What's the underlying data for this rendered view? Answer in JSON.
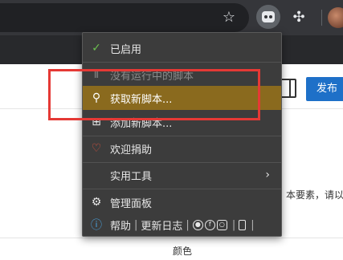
{
  "toolbar": {
    "icons": {
      "star": "star-icon",
      "extension_active": "tampermonkey-icon",
      "puzzle": "puzzle-icon",
      "avatar": "avatar"
    }
  },
  "page": {
    "publish_label": "发布",
    "fragment_text": "本要素，请以",
    "color_label": "颜色"
  },
  "menu": {
    "items": [
      {
        "icon": "check-icon",
        "label": "已启用"
      },
      {
        "icon": "script-icon",
        "label": "没有运行中的脚本"
      },
      {
        "icon": "search-icon",
        "label": "获取新脚本..."
      },
      {
        "icon": "add-icon",
        "label": "添加新脚本..."
      },
      {
        "icon": "heart-icon",
        "label": "欢迎捐助"
      },
      {
        "icon": "",
        "label": "实用工具"
      },
      {
        "icon": "gear-icon",
        "label": "管理面板"
      }
    ],
    "help": {
      "icon": "info-icon",
      "help_label": "帮助",
      "changelog_label": "更新日志",
      "separator": "|",
      "social_icons": [
        "github-icon",
        "facebook-icon",
        "instagram-icon"
      ],
      "device_icon": "mobile-icon"
    }
  },
  "colors": {
    "menu_bg": "#3c3c3c",
    "highlight": "#8a6a1e",
    "annotation": "#e53935",
    "publish_bg": "#1e70c8",
    "check": "#6cbf4f",
    "heart": "#e0533f",
    "info": "#4aa3e0"
  }
}
